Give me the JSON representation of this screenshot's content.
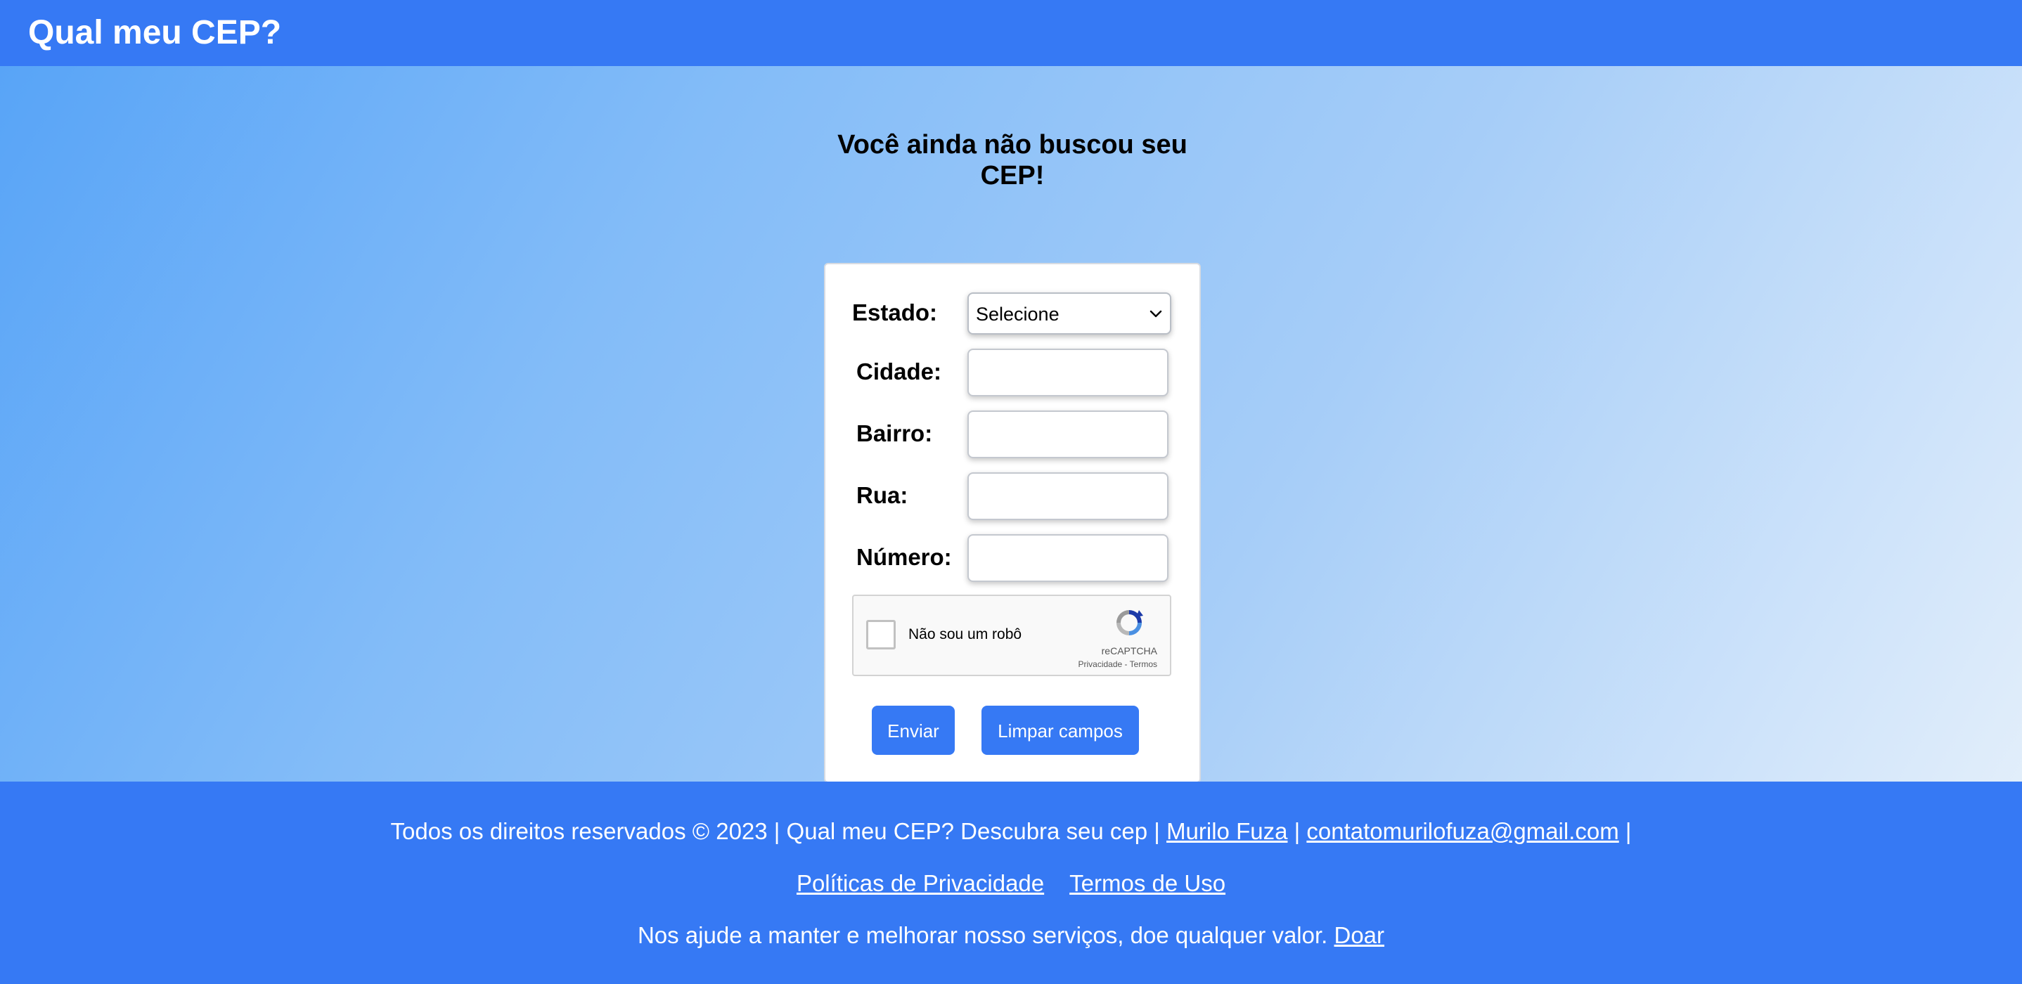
{
  "header": {
    "title": "Qual meu CEP?"
  },
  "main": {
    "headline_line1": "Você ainda não buscou seu",
    "headline_line2": "CEP!"
  },
  "form": {
    "estado_label": "Estado:",
    "estado_selected": "Selecione",
    "cidade_label": "Cidade:",
    "cidade_value": "",
    "bairro_label": "Bairro:",
    "bairro_value": "",
    "rua_label": "Rua:",
    "rua_value": "",
    "numero_label": "Número:",
    "numero_value": "",
    "submit_label": "Enviar",
    "clear_label": "Limpar campos"
  },
  "captcha": {
    "label": "Não sou um robô",
    "brand": "reCAPTCHA",
    "privacy": "Privacidade",
    "separator": " - ",
    "terms": "Termos"
  },
  "footer": {
    "copyright": "Todos os direitos reservados © 2023 | Qual meu CEP? Descubra seu cep |",
    "author": "Murilo Fuza",
    "sep1": "|",
    "email": "contatomurilofuza@gmail.com",
    "sep2": "|",
    "privacy_policy": "Políticas de Privacidade",
    "terms_of_use": "Termos de Uso",
    "donate_text": "Nos ajude a manter e melhorar nosso serviços, doe qualquer valor.",
    "donate_link": "Doar"
  },
  "colors": {
    "primary": "#3679f4",
    "gradient_start": "#56a3f7",
    "gradient_end": "#e9f2fb"
  }
}
